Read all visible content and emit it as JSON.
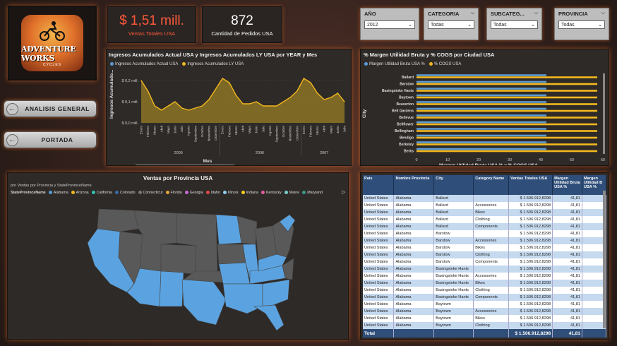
{
  "logo": {
    "title": "ADVENTURE WORKS",
    "sub": "CYCLES"
  },
  "nav": {
    "analisis_label": "ANALISIS GENERAL",
    "portada_label": "PORTADA"
  },
  "kpis": {
    "ventas_value": "$ 1,51 mill.",
    "ventas_label": "Ventas Totales USA",
    "pedidos_value": "872",
    "pedidos_label": "Cantidad de Pedidos USA"
  },
  "filters": [
    {
      "title": "AÑO",
      "value": "2012"
    },
    {
      "title": "CATEGORIA",
      "value": "Todas"
    },
    {
      "title": "SUBCATEG...",
      "value": "Todas"
    },
    {
      "title": "PROVINCIA",
      "value": "Todas"
    }
  ],
  "colors": {
    "blue": "#5b9bd5",
    "gold": "#f2b81e",
    "accent": "#ff7a30"
  },
  "line_panel": {
    "title": "Ingresos Acumulados Actual USA y Ingresos Acumulados LY USA por YEAR y Mes",
    "legend": [
      "Ingresos Acumulados Actual USA",
      "Ingresos Acumulados LY USA"
    ],
    "ylabel": "Ingresos Acumulado...",
    "xlabel": "Mes"
  },
  "bar_panel": {
    "title": "% Margen Utilidad Bruta y % COGS por Ciudad USA",
    "legend": [
      "Margen Utilidad Bruta USA %",
      "% COGS USA"
    ],
    "ylabel": "City",
    "xlabel": "Margen Utilidad Bruta USA % y % COGS USA"
  },
  "map_panel": {
    "title": "Ventas por Provincia USA",
    "subtitle": "por Ventas por Provincia y StateProvinceName",
    "legend_title": "StateProvinceName",
    "legend": [
      {
        "name": "Alabama",
        "color": "#5b9bd5"
      },
      {
        "name": "Arizona",
        "color": "#f2b81e"
      },
      {
        "name": "California",
        "color": "#2ec4b6"
      },
      {
        "name": "Colorado",
        "color": "#3a6ea5"
      },
      {
        "name": "Connecticut",
        "color": "#777777"
      },
      {
        "name": "Florida",
        "color": "#e8a33b"
      },
      {
        "name": "Georgia",
        "color": "#c96bd6"
      },
      {
        "name": "Idaho",
        "color": "#e04848"
      },
      {
        "name": "Illinois",
        "color": "#8fd0ee"
      },
      {
        "name": "Indiana",
        "color": "#f5d020"
      },
      {
        "name": "Kentucky",
        "color": "#e25fa0"
      },
      {
        "name": "Maine",
        "color": "#7ad0c9"
      },
      {
        "name": "Maryland",
        "color": "#3a9a8a"
      }
    ]
  },
  "table": {
    "headers": [
      "Pais",
      "Nombre Provincia",
      "City",
      "Category Name",
      "Ventas Totales USA",
      "Margen Utilidad Bruta USA %",
      "Margen Utilidad B USA %"
    ],
    "rows": [
      [
        "United States",
        "Alabama",
        "Ballard",
        "",
        "$ 1.506.912,8298",
        "41,81",
        ""
      ],
      [
        "United States",
        "Alabama",
        "Ballard",
        "Accessories",
        "$ 1.506.912,8298",
        "41,81",
        ""
      ],
      [
        "United States",
        "Alabama",
        "Ballard",
        "Bikes",
        "$ 1.506.912,8298",
        "41,81",
        ""
      ],
      [
        "United States",
        "Alabama",
        "Ballard",
        "Clothing",
        "$ 1.506.912,8298",
        "41,81",
        ""
      ],
      [
        "United States",
        "Alabama",
        "Ballard",
        "Components",
        "$ 1.506.912,8298",
        "41,81",
        ""
      ],
      [
        "United States",
        "Alabama",
        "Barstow",
        "",
        "$ 1.506.912,8298",
        "41,81",
        ""
      ],
      [
        "United States",
        "Alabama",
        "Barstow",
        "Accessories",
        "$ 1.506.912,8298",
        "41,81",
        ""
      ],
      [
        "United States",
        "Alabama",
        "Barstow",
        "Bikes",
        "$ 1.506.912,8298",
        "41,81",
        ""
      ],
      [
        "United States",
        "Alabama",
        "Barstow",
        "Clothing",
        "$ 1.506.912,8298",
        "41,81",
        ""
      ],
      [
        "United States",
        "Alabama",
        "Barstow",
        "Components",
        "$ 1.506.912,8298",
        "41,81",
        ""
      ],
      [
        "United States",
        "Alabama",
        "Basingstoke Hants",
        "",
        "$ 1.506.912,8298",
        "41,81",
        ""
      ],
      [
        "United States",
        "Alabama",
        "Basingstoke Hants",
        "Accessories",
        "$ 1.506.912,8298",
        "41,81",
        ""
      ],
      [
        "United States",
        "Alabama",
        "Basingstoke Hants",
        "Bikes",
        "$ 1.506.912,8298",
        "41,81",
        ""
      ],
      [
        "United States",
        "Alabama",
        "Basingstoke Hants",
        "Clothing",
        "$ 1.506.912,8298",
        "41,81",
        ""
      ],
      [
        "United States",
        "Alabama",
        "Basingstoke Hants",
        "Components",
        "$ 1.506.912,8298",
        "41,81",
        ""
      ],
      [
        "United States",
        "Alabama",
        "Baytown",
        "",
        "$ 1.506.912,8298",
        "41,81",
        ""
      ],
      [
        "United States",
        "Alabama",
        "Baytown",
        "Accessories",
        "$ 1.506.912,8298",
        "41,81",
        ""
      ],
      [
        "United States",
        "Alabama",
        "Baytown",
        "Bikes",
        "$ 1.506.912,8298",
        "41,81",
        ""
      ],
      [
        "United States",
        "Alabama",
        "Baytown",
        "Clothing",
        "$ 1.506.912,8298",
        "41,81",
        ""
      ]
    ],
    "total": [
      "Total",
      "",
      "",
      "",
      "$ 1.506.912,8298",
      "41,81",
      ""
    ]
  },
  "chart_data": [
    {
      "type": "area",
      "title": "Ingresos Acumulados Actual USA y Ingresos Acumulados LY USA por YEAR y Mes",
      "xlabel": "Mes",
      "ylabel": "Ingresos Acumulado...",
      "yticks": [
        "$ 0,0 mill.",
        "$ 0,1 mill.",
        "$ 0,2 mill."
      ],
      "ylim": [
        0,
        0.24
      ],
      "groups": [
        "2005",
        "2006",
        "2007"
      ],
      "categories": [
        "Enero",
        "Febrero",
        "Marzo",
        "Abril",
        "Mayo",
        "Junio",
        "Julio",
        "Agosto",
        "Septiembre",
        "Octubre",
        "Noviembre",
        "Diciembre",
        "Enero",
        "Febrero",
        "Marzo",
        "Abril",
        "Mayo",
        "Junio",
        "Julio",
        "Agosto",
        "Septiembre",
        "Octubre",
        "Noviembre",
        "Diciembre",
        "Enero",
        "Febrero",
        "Marzo",
        "Abril",
        "Mayo",
        "Junio",
        "Julio"
      ],
      "series": [
        {
          "name": "Ingresos Acumulados LY USA",
          "values": [
            0.2,
            0.15,
            0.08,
            0.06,
            0.08,
            0.1,
            0.07,
            0.06,
            0.07,
            0.08,
            0.11,
            0.16,
            0.21,
            0.19,
            0.13,
            0.09,
            0.09,
            0.1,
            0.08,
            0.08,
            0.08,
            0.1,
            0.12,
            0.15,
            0.21,
            0.19,
            0.14,
            0.11,
            0.12,
            0.14,
            0.1
          ]
        }
      ]
    },
    {
      "type": "bar",
      "orientation": "horizontal",
      "title": "% Margen Utilidad Bruta y % COGS por Ciudad USA",
      "xlabel": "Margen Utilidad Bruta USA % y % COGS USA",
      "ylabel": "City",
      "xlim": [
        0,
        60
      ],
      "xticks": [
        0,
        10,
        20,
        30,
        40,
        50,
        60
      ],
      "categories": [
        "Ballard",
        "Barstow",
        "Basingstoke Hants",
        "Baytown",
        "Beaverton",
        "Bell Gardens",
        "Bellevue",
        "Bellflower",
        "Bellingham",
        "Bendigo",
        "Berkeley",
        "Berks"
      ],
      "series": [
        {
          "name": "Margen Utilidad Bruta USA %",
          "values": [
            41.81,
            41.81,
            41.81,
            41.81,
            41.81,
            41.81,
            41.81,
            41.81,
            41.81,
            41.81,
            41.81,
            41.81
          ]
        },
        {
          "name": "% COGS USA",
          "values": [
            58.19,
            58.19,
            58.19,
            58.19,
            58.19,
            58.19,
            58.19,
            58.19,
            58.19,
            58.19,
            58.19,
            58.19
          ]
        }
      ]
    }
  ]
}
